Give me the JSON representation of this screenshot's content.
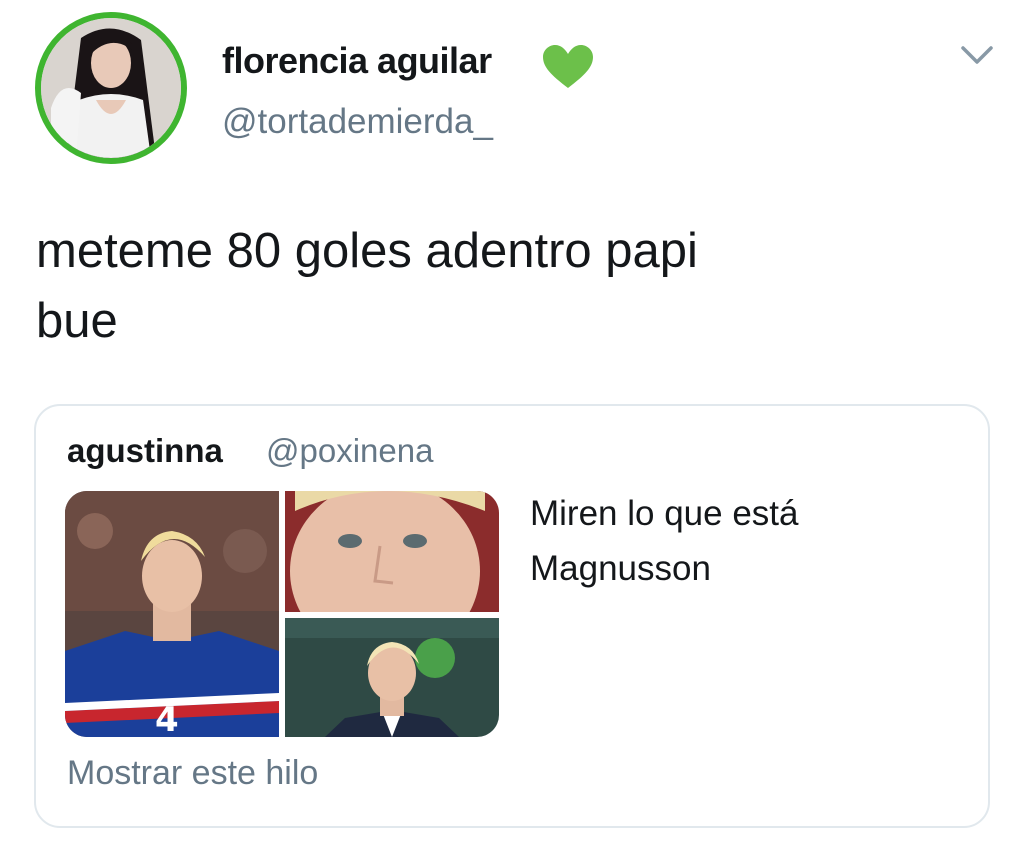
{
  "tweet": {
    "author": {
      "display_name": "florencia aguilar",
      "handle": "@tortademierda_",
      "badge_icon": "green-heart-icon",
      "avatar_ring_color": "#3fb530"
    },
    "menu_icon": "chevron-down-icon",
    "text": "meteme 80 goles adentro papi\nbue"
  },
  "quote": {
    "author_name": "agustinna",
    "author_handle": "@poxinena",
    "text": "Miren lo que está Magnusson",
    "show_thread_label": "Mostrar este hilo",
    "media_count": 3
  },
  "colors": {
    "text_primary": "#14171a",
    "text_secondary": "#657786",
    "border": "#e1e8ed",
    "heart": "#6cc04a"
  }
}
